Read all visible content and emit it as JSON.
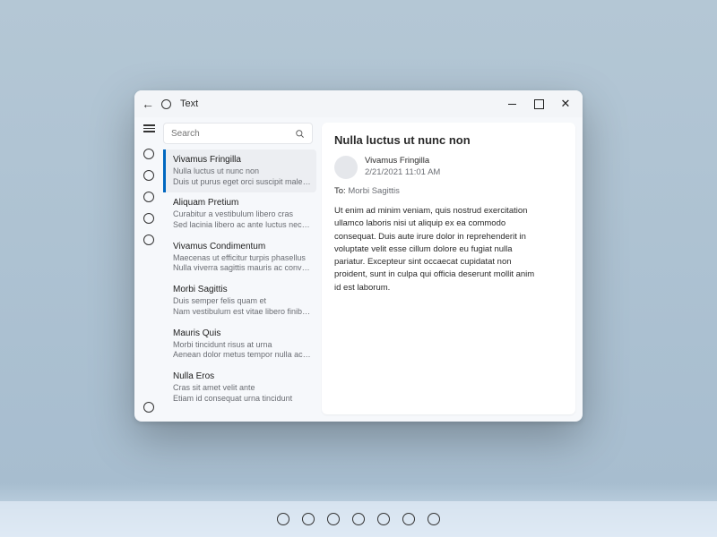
{
  "window": {
    "title": "Text"
  },
  "search": {
    "placeholder": "Search",
    "value": ""
  },
  "messages": [
    {
      "from": "Vivamus Fringilla",
      "subject": "Nulla luctus ut nunc non",
      "preview": "Duis ut purus eget orci suscipit malesuada",
      "selected": true
    },
    {
      "from": "Aliquam Pretium",
      "subject": "Curabitur a vestibulum libero cras",
      "preview": "Sed lacinia libero ac ante luctus nec interdum"
    },
    {
      "from": "Vivamus Condimentum",
      "subject": "Maecenas ut efficitur turpis phasellus",
      "preview": "Nulla viverra sagittis mauris ac convallis"
    },
    {
      "from": "Morbi Sagittis",
      "subject": "Duis semper felis quam et",
      "preview": "Nam vestibulum est vitae libero finibus et"
    },
    {
      "from": "Mauris Quis",
      "subject": "Morbi tincidunt risus at urna",
      "preview": "Aenean dolor metus tempor nulla ac dapibus"
    },
    {
      "from": "Nulla Eros",
      "subject": "Cras sit amet velit ante",
      "preview": "Etiam id consequat urna tincidunt"
    }
  ],
  "reading": {
    "subject": "Nulla luctus ut nunc non",
    "sender": "Vivamus Fringilla",
    "date": "2/21/2021 11:01 AM",
    "to_label": "To:",
    "to_value": "Morbi Sagittis",
    "body": "Ut enim ad minim veniam, quis nostrud exercitation ullamco laboris nisi ut aliquip ex ea commodo consequat. Duis aute irure dolor in reprehenderit in voluptate velit esse cillum dolore eu fugiat nulla pariatur. Excepteur sint occaecat cupidatat non proident, sunt in culpa qui officia deserunt mollit anim id est laborum."
  },
  "taskbar": {
    "items": 7
  }
}
